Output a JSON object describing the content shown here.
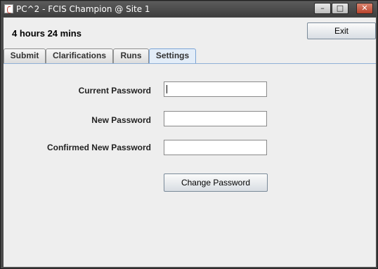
{
  "window": {
    "title": "PC^2 - FCIS Champion @ Site 1",
    "minimize_glyph": "–",
    "maximize_glyph": "□",
    "close_glyph": "✕"
  },
  "header": {
    "clock": "4 hours 24 mins",
    "exit_label": "Exit"
  },
  "tabs": [
    {
      "label": "Submit"
    },
    {
      "label": "Clarifications"
    },
    {
      "label": "Runs"
    },
    {
      "label": "Settings",
      "active": true
    }
  ],
  "settings": {
    "current_password_label": "Current Password",
    "current_password_value": "",
    "new_password_label": "New Password",
    "new_password_value": "",
    "confirm_password_label": "Confirmed New Password",
    "confirm_password_value": "",
    "change_button_label": "Change Password"
  }
}
